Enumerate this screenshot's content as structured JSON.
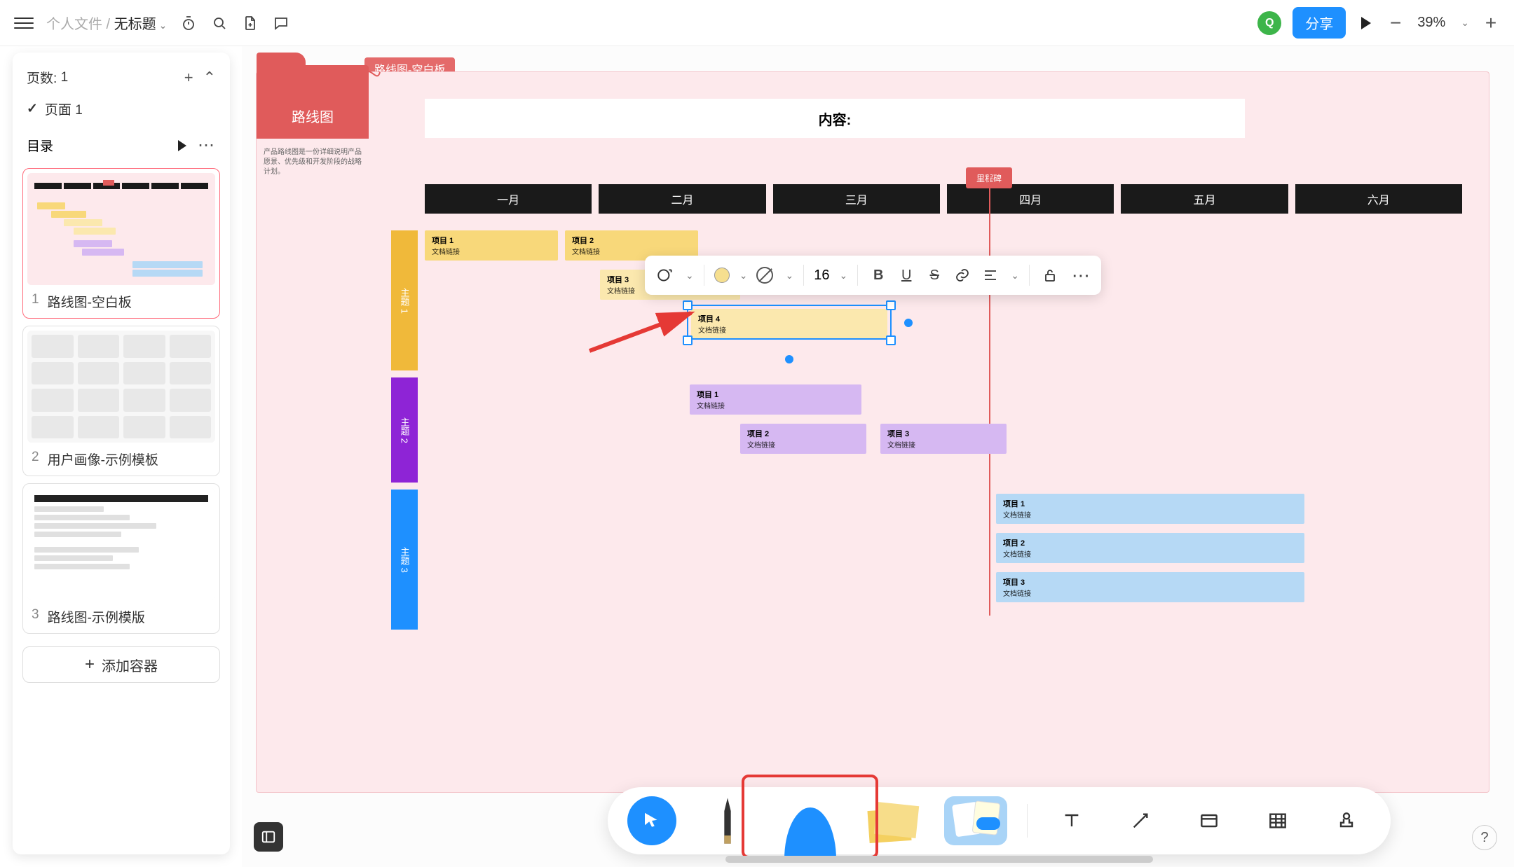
{
  "topbar": {
    "breadcrumb_root": "个人文件",
    "breadcrumb_sep": " / ",
    "breadcrumb_title": "无标题",
    "share": "分享",
    "zoom": "39%"
  },
  "avatar_initial": "Q",
  "leftpanel": {
    "pages_label": "页数:",
    "pages_count": "1",
    "page1": "页面 1",
    "toc": "目录",
    "thumbs": [
      {
        "n": "1",
        "label": "路线图-空白板"
      },
      {
        "n": "2",
        "label": "用户画像-示例模板"
      },
      {
        "n": "3",
        "label": "路线图-示例模版"
      }
    ],
    "add_container": "添加容器"
  },
  "template_chip": "路线图-空白板",
  "folder_title": "路线图",
  "desc": "产品路线图是一份详细说明产品愿景、优先级和开发阶段的战略计划。",
  "content_header": "内容:",
  "now_marker": "里程碑",
  "months": [
    "一月",
    "二月",
    "三月",
    "四月",
    "五月",
    "六月"
  ],
  "lanes": {
    "l1": "主题 1",
    "l2": "主题 2",
    "l3": "主题 3"
  },
  "bars": {
    "p1": {
      "t": "项目 1",
      "s": "文档链接"
    },
    "p2": {
      "t": "项目 2",
      "s": "文档链接"
    },
    "p3": {
      "t": "项目 3",
      "s": "文档链接"
    },
    "p4": {
      "t": "项目 4",
      "s": "文档链接"
    },
    "q1": {
      "t": "项目 1",
      "s": "文档链接"
    },
    "q2": {
      "t": "项目 2",
      "s": "文档链接"
    },
    "q3": {
      "t": "项目 3",
      "s": "文档链接"
    },
    "r1": {
      "t": "项目 1",
      "s": "文档链接"
    },
    "r2": {
      "t": "项目 2",
      "s": "文档链接"
    },
    "r3": {
      "t": "项目 3",
      "s": "文档链接"
    }
  },
  "txtbar": {
    "font_size": "16"
  },
  "help": "?"
}
